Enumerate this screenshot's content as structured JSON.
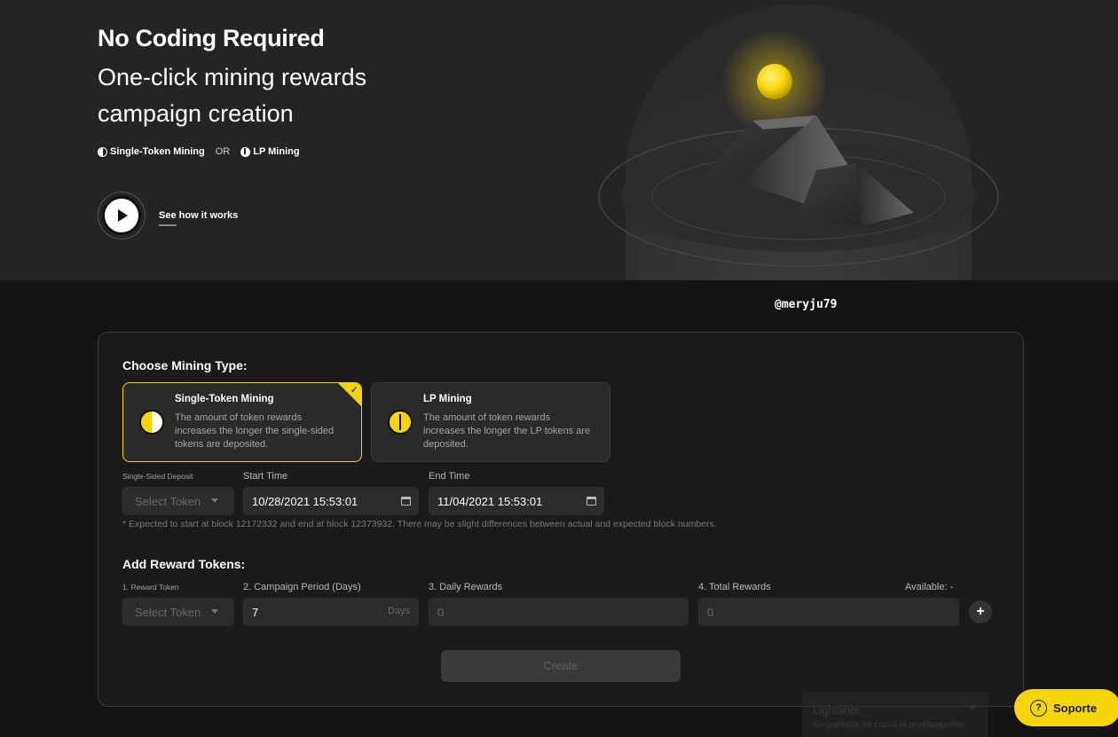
{
  "hero": {
    "title": "No Coding Required",
    "subtitle": "One-click mining rewards campaign creation",
    "single_label": "Single-Token Mining",
    "or_label": "OR",
    "lp_label": "LP Mining",
    "see_how": "See how it works"
  },
  "watermark": "@meryju79",
  "choose": {
    "title": "Choose Mining Type:",
    "cards": [
      {
        "title": "Single-Token Mining",
        "desc": "The amount of token rewards increases the longer the single-sided tokens are deposited.",
        "selected": true
      },
      {
        "title": "LP Mining",
        "desc": "The amount of token rewards increases the longer the LP tokens are deposited.",
        "selected": false
      }
    ]
  },
  "deposit": {
    "token_label": "Single-Sided Deposit",
    "token_placeholder": "Select Token",
    "start_label": "Start Time",
    "start_value": "10/28/2021 15:53:01",
    "end_label": "End Time",
    "end_value": "11/04/2021 15:53:01",
    "note": "* Expected to start at block 12172332 and end at block 12373932. There may be slight differences between actual and expected block numbers."
  },
  "rewards": {
    "title": "Add Reward Tokens:",
    "token_label": "1. Reward Token",
    "token_placeholder": "Select Token",
    "period_label": "2. Campaign Period (Days)",
    "period_value": "7",
    "period_unit": "Days",
    "daily_label": "3. Daily Rewards",
    "daily_value": "0",
    "total_label": "4. Total Rewards",
    "total_value": "0",
    "available": "Available: -",
    "add": "+"
  },
  "create_label": "Create",
  "toast": {
    "title": "Lightshot",
    "message": "Su pantalla se copió al portapapeles",
    "close": "×"
  },
  "support": {
    "icon": "?",
    "label": "Soporte"
  },
  "colors": {
    "accent": "#f5d50a",
    "hero_bg": "#242426",
    "page_bg": "#141414"
  }
}
